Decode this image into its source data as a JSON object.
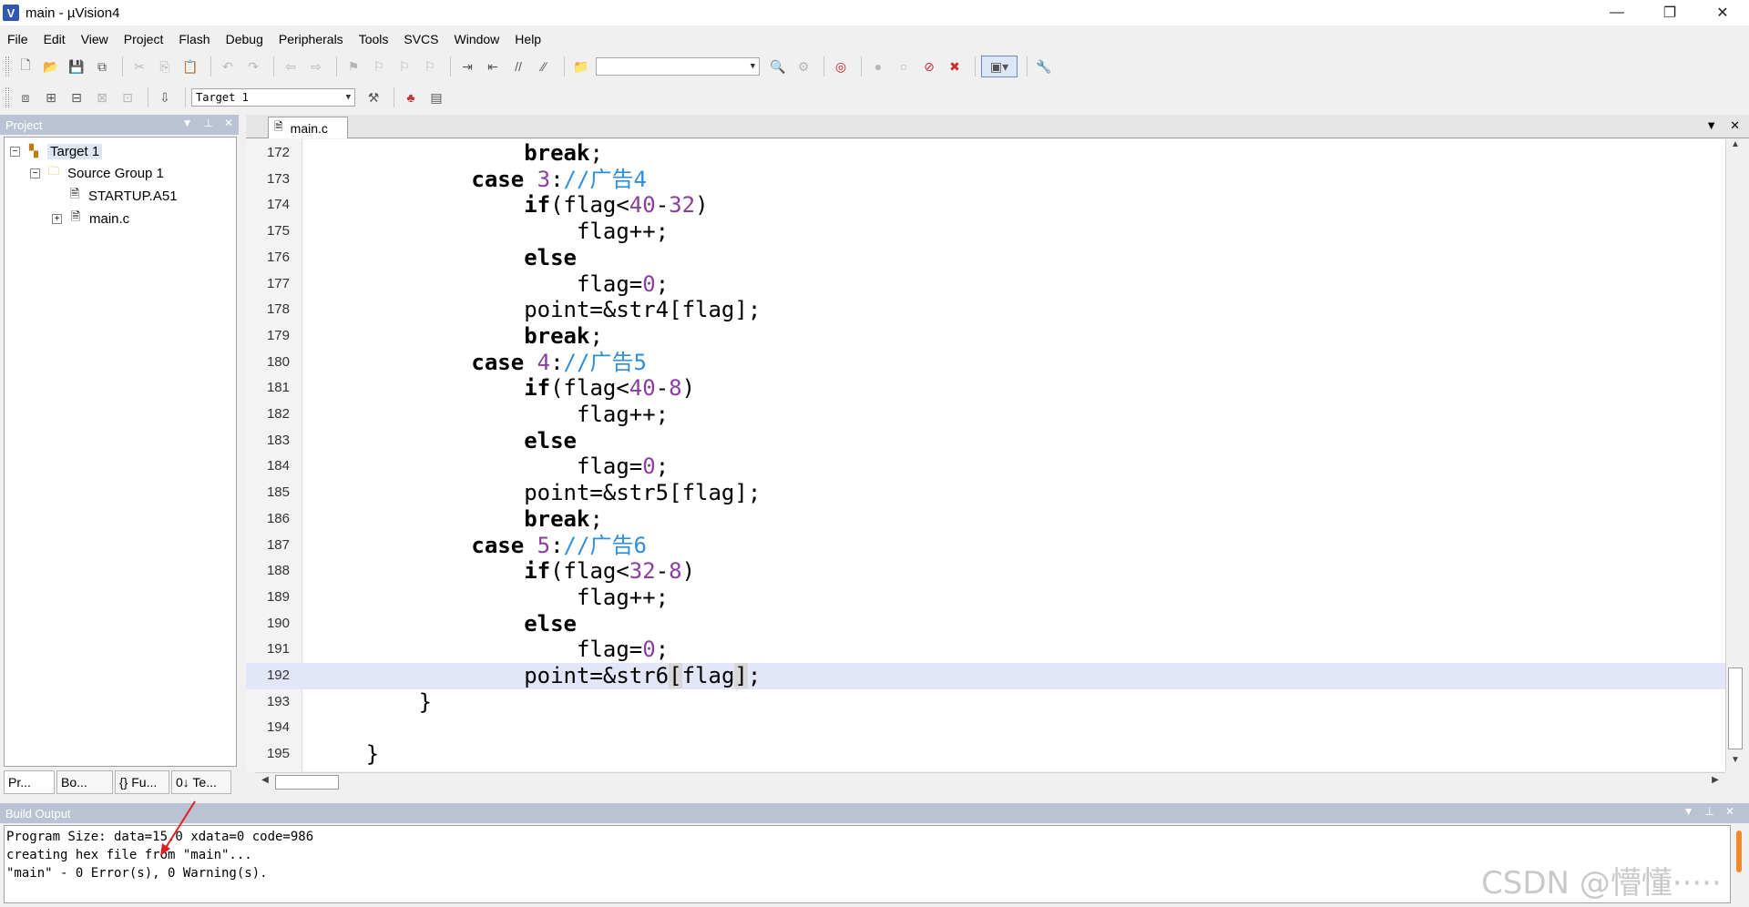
{
  "window": {
    "title": "main  - µVision4",
    "logo_letter": "V",
    "controls": [
      "—",
      "❐",
      "✕"
    ]
  },
  "menu": [
    "File",
    "Edit",
    "View",
    "Project",
    "Flash",
    "Debug",
    "Peripherals",
    "Tools",
    "SVCS",
    "Window",
    "Help"
  ],
  "toolbar": {
    "find_value": "",
    "target_select": "Target 1"
  },
  "project_panel": {
    "title": "Project",
    "tree": {
      "target": "Target 1",
      "group": "Source Group 1",
      "files": [
        "STARTUP.A51",
        "main.c"
      ]
    },
    "tabs": [
      "Pr...",
      "Bo...",
      "{} Fu...",
      "0↓ Te..."
    ]
  },
  "editor": {
    "tab_label": "main.c",
    "current_line": "192",
    "lines": [
      {
        "n": "172",
        "code": "                break;"
      },
      {
        "n": "173",
        "code": "            case 3://广告4"
      },
      {
        "n": "174",
        "code": "                if(flag<40-32)"
      },
      {
        "n": "175",
        "code": "                    flag++;"
      },
      {
        "n": "176",
        "code": "                else"
      },
      {
        "n": "177",
        "code": "                    flag=0;"
      },
      {
        "n": "178",
        "code": "                point=&str4[flag];"
      },
      {
        "n": "179",
        "code": "                break;"
      },
      {
        "n": "180",
        "code": "            case 4://广告5"
      },
      {
        "n": "181",
        "code": "                if(flag<40-8)"
      },
      {
        "n": "182",
        "code": "                    flag++;"
      },
      {
        "n": "183",
        "code": "                else"
      },
      {
        "n": "184",
        "code": "                    flag=0;"
      },
      {
        "n": "185",
        "code": "                point=&str5[flag];"
      },
      {
        "n": "186",
        "code": "                break;"
      },
      {
        "n": "187",
        "code": "            case 5://广告6"
      },
      {
        "n": "188",
        "code": "                if(flag<32-8)"
      },
      {
        "n": "189",
        "code": "                    flag++;"
      },
      {
        "n": "190",
        "code": "                else"
      },
      {
        "n": "191",
        "code": "                    flag=0;"
      },
      {
        "n": "192",
        "code": "                point=&str6[flag];"
      },
      {
        "n": "193",
        "code": "        }"
      },
      {
        "n": "194",
        "code": ""
      },
      {
        "n": "195",
        "code": "    }"
      }
    ]
  },
  "build_output": {
    "title": "Build Output",
    "lines": [
      "Program Size: data=15.0 xdata=0 code=986",
      "creating hex file from \"main\"...",
      "\"main\" - 0 Error(s), 0 Warning(s)."
    ]
  },
  "watermark": "CSDN @懵懂·····",
  "colors": {
    "panel_header": "#b9c3d4",
    "current_line_bg": "#e3e6f8",
    "keyword": "#000000",
    "number": "#8a3ea0",
    "comment": "#2e8fd8",
    "annotation_arrow": "#e02020"
  }
}
